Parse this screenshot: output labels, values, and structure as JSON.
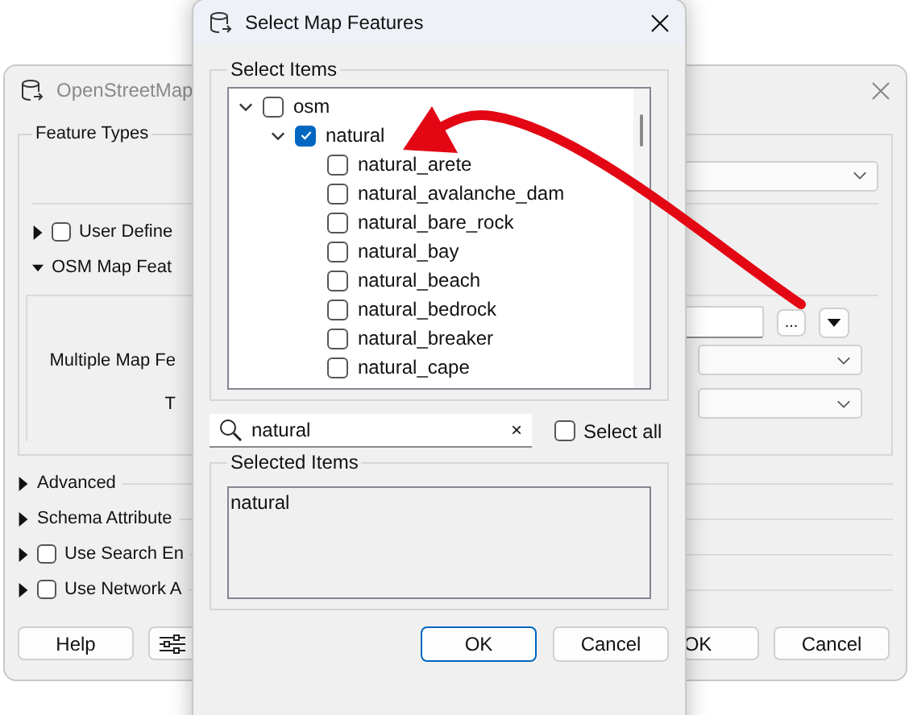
{
  "background_window": {
    "title": "OpenStreetMap",
    "group_title": "Feature Types",
    "sections": [
      {
        "kind": "checkbox",
        "label": "User Define",
        "expanded": false,
        "checked": false
      },
      {
        "kind": "plain",
        "label": "OSM Map Feat",
        "expanded": true
      }
    ],
    "browse_button": "...",
    "fields": [
      {
        "label": "Multiple Map Fe"
      },
      {
        "label": "T"
      }
    ],
    "more_sections": [
      {
        "kind": "plain",
        "label": "Advanced",
        "expanded": false
      },
      {
        "kind": "plain",
        "label": "Schema Attribute",
        "expanded": false
      },
      {
        "kind": "checkbox",
        "label": "Use Search En",
        "expanded": false,
        "checked": false
      },
      {
        "kind": "checkbox",
        "label": "Use Network A",
        "expanded": false,
        "checked": false
      }
    ],
    "buttons": {
      "help": "Help",
      "ok": "OK",
      "cancel": "Cancel"
    }
  },
  "dialog": {
    "title": "Select Map Features",
    "group_title": "Select Items",
    "tree": [
      {
        "label": "osm",
        "checked": false,
        "expanded": true,
        "children": [
          {
            "label": "natural",
            "checked": true,
            "expanded": true,
            "children": [
              {
                "label": "natural_arete",
                "checked": false
              },
              {
                "label": "natural_avalanche_dam",
                "checked": false
              },
              {
                "label": "natural_bare_rock",
                "checked": false
              },
              {
                "label": "natural_bay",
                "checked": false
              },
              {
                "label": "natural_beach",
                "checked": false
              },
              {
                "label": "natural_bedrock",
                "checked": false
              },
              {
                "label": "natural_breaker",
                "checked": false
              },
              {
                "label": "natural_cape",
                "checked": false
              }
            ]
          }
        ]
      }
    ],
    "search": {
      "value": "natural",
      "clear": "×"
    },
    "select_all": {
      "label": "Select all",
      "checked": false
    },
    "selected_items": {
      "title": "Selected Items",
      "text": "natural"
    },
    "buttons": [
      {
        "label": "OK",
        "focused": true
      },
      {
        "label": "Cancel",
        "focused": false
      }
    ]
  }
}
